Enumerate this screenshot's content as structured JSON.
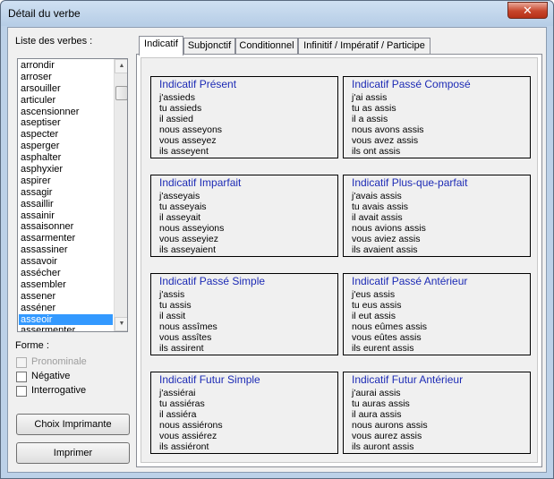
{
  "window": {
    "title": "Détail du verbe",
    "close_glyph": "✕"
  },
  "sidebar": {
    "list_label": "Liste des verbes :",
    "verbs": [
      "arrondir",
      "arroser",
      "arsouiller",
      "articuler",
      "ascensionner",
      "aseptiser",
      "aspecter",
      "asperger",
      "asphalter",
      "asphyxier",
      "aspirer",
      "assagir",
      "assaillir",
      "assainir",
      "assaisonner",
      "assarmenter",
      "assassiner",
      "assavoir",
      "assécher",
      "assembler",
      "assener",
      "asséner",
      "asseoir",
      "assermenter"
    ],
    "selected_verb": "asseoir",
    "forme_label": "Forme :",
    "options": [
      {
        "label": "Pronominale",
        "checked": false,
        "disabled": true
      },
      {
        "label": "Négative",
        "checked": false,
        "disabled": false
      },
      {
        "label": "Interrogative",
        "checked": false,
        "disabled": false
      }
    ],
    "printer_button": "Choix Imprimante",
    "print_button": "Imprimer"
  },
  "tabs": [
    {
      "label": "Indicatif",
      "active": true
    },
    {
      "label": "Subjonctif",
      "active": false
    },
    {
      "label": "Conditionnel",
      "active": false
    },
    {
      "label": "Infinitif / Impératif / Participe",
      "active": false
    }
  ],
  "tenses": [
    {
      "title": "Indicatif Présent",
      "lines": [
        "j'assieds",
        "tu assieds",
        "il assied",
        "nous asseyons",
        "vous asseyez",
        "ils asseyent"
      ]
    },
    {
      "title": "Indicatif Passé Composé",
      "lines": [
        "j'ai assis",
        "tu as assis",
        "il a assis",
        "nous avons assis",
        "vous avez assis",
        "ils ont assis"
      ]
    },
    {
      "title": "Indicatif Imparfait",
      "lines": [
        "j'asseyais",
        "tu asseyais",
        "il asseyait",
        "nous asseyions",
        "vous asseyiez",
        "ils asseyaient"
      ]
    },
    {
      "title": "Indicatif Plus-que-parfait",
      "lines": [
        "j'avais assis",
        "tu avais assis",
        "il avait assis",
        "nous avions assis",
        "vous aviez assis",
        "ils avaient assis"
      ]
    },
    {
      "title": "Indicatif Passé Simple",
      "lines": [
        "j'assis",
        "tu assis",
        "il assit",
        "nous assîmes",
        "vous assîtes",
        "ils assirent"
      ]
    },
    {
      "title": "Indicatif Passé Antérieur",
      "lines": [
        "j'eus assis",
        "tu eus assis",
        "il eut assis",
        "nous eûmes assis",
        "vous eûtes assis",
        "ils eurent assis"
      ]
    },
    {
      "title": "Indicatif Futur Simple",
      "lines": [
        "j'assiérai",
        "tu assiéras",
        "il assiéra",
        "nous assiérons",
        "vous assiérez",
        "ils assiéront"
      ]
    },
    {
      "title": "Indicatif Futur Antérieur",
      "lines": [
        "j'aurai assis",
        "tu auras assis",
        "il aura assis",
        "nous aurons assis",
        "vous aurez assis",
        "ils auront assis"
      ]
    }
  ],
  "colors": {
    "tense_title": "#1d2bb5",
    "selection": "#3399ff"
  }
}
